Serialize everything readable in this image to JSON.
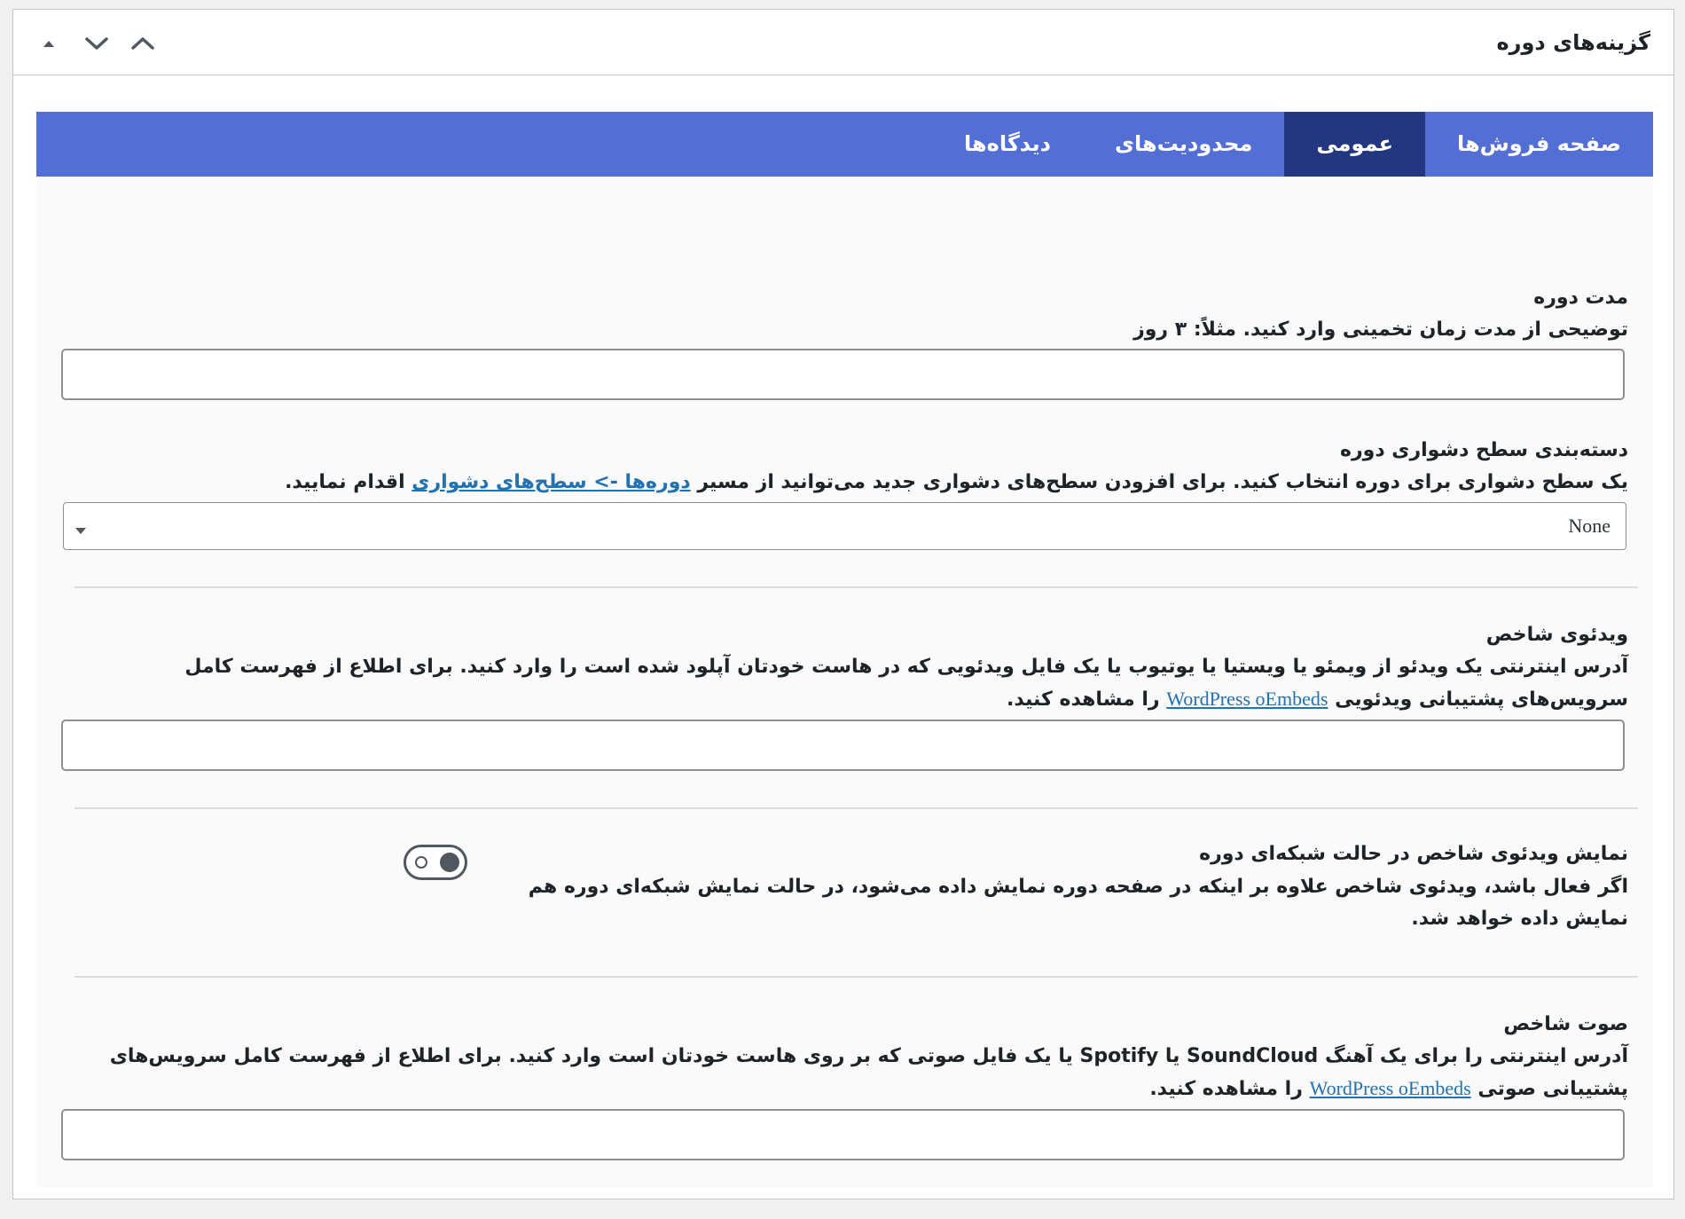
{
  "metabox": {
    "title": "گزینه‌های دوره",
    "actions": [
      {
        "name": "move-up",
        "icon": "chevron-up-icon"
      },
      {
        "name": "move-down",
        "icon": "chevron-down-icon"
      },
      {
        "name": "toggle-panel",
        "icon": "triangle-up-icon"
      }
    ]
  },
  "tabs": [
    {
      "label": "صفحه فروش‌ها",
      "active": false
    },
    {
      "label": "عمومی",
      "active": true
    },
    {
      "label": "محدودیت‌های",
      "active": false
    },
    {
      "label": "دیدگاه‌ها",
      "active": false
    }
  ],
  "colors": {
    "tab_bar": "#536ed4",
    "tab_active": "#22377f",
    "link": "#2271b1"
  },
  "fields": {
    "duration": {
      "title": "مدت دوره",
      "description": "توضیحی از مدت زمان تخمینی وارد کنید. مثلاً: ۳ روز",
      "value": ""
    },
    "difficulty": {
      "title": "دسته‌بندی سطح دشواری دوره",
      "desc_before": "یک سطح دشواری برای دوره انتخاب کنید. برای افزودن سطح‌های دشواری جدید می‌توانید از مسیر",
      "link": "دوره‌ها -> سطح‌های دشواری",
      "desc_after": "اقدام نمایید.",
      "selected": "None"
    },
    "intro_video": {
      "title": "ویدئوی شاخص",
      "desc_before": "آدرس اینترنتی یک ویدئو از ویمئو یا ویستیا یا یوتیوب یا یک فایل ویدئویی که در هاست خودتان آپلود شده است را وارد کنید. برای اطلاع از فهرست کامل سرویس‌های پشتیبانی ویدئویی",
      "link": "WordPress oEmbeds",
      "desc_after": "را مشاهده کنید.",
      "value": ""
    },
    "grid_video": {
      "title": "نمایش ویدئوی شاخص در حالت شبکه‌ای دوره",
      "description": "اگر فعال باشد، ویدئوی شاخص علاوه بر اینکه در صفحه دوره نمایش داده می‌شود، در حالت نمایش شبکه‌ای دوره هم نمایش داده خواهد شد.",
      "enabled": true
    },
    "intro_audio": {
      "title": "صوت شاخص",
      "desc_before": "آدرس اینترنتی را برای یک آهنگ SoundCloud یا Spotify یا یک فایل صوتی که بر روی هاست خودتان است وارد کنید. برای اطلاع از فهرست کامل سرویس‌های پشتیبانی صوتی",
      "link": "WordPress oEmbeds",
      "desc_after": "را مشاهده کنید.",
      "value": ""
    }
  }
}
